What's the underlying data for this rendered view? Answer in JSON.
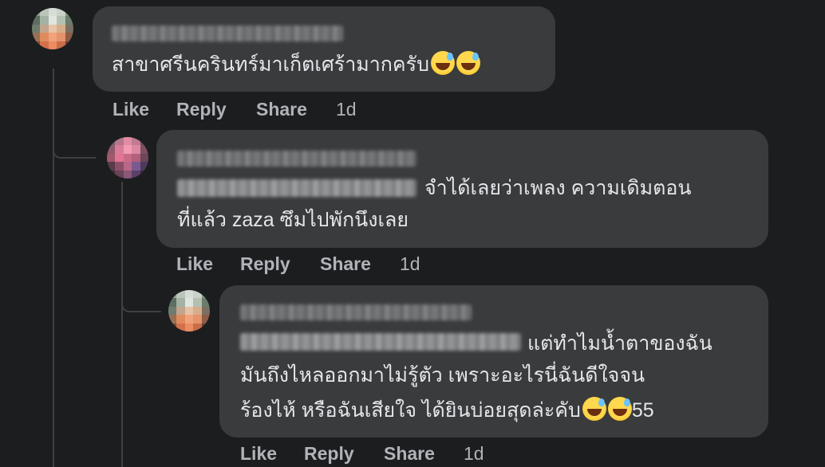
{
  "comments": [
    {
      "text": "สาขาศรีนครินทร์มาเก็ตเศร้ามากครับ",
      "emoji": [
        "grinning-sweat-emoji",
        "grinning-sweat-emoji"
      ],
      "actions": {
        "like": "Like",
        "reply": "Reply",
        "share": "Share",
        "time": "1d"
      }
    },
    {
      "line1": "จำได้เลยว่าเพลง ความเดิมตอน",
      "line2": "ที่แล้ว zaza ซึมไปพักนึงเลย",
      "actions": {
        "like": "Like",
        "reply": "Reply",
        "share": "Share",
        "time": "1d"
      }
    },
    {
      "line1": "แต่ทำไมน้ำตาของฉัน",
      "line2": "มันถึงไหลออกมาไม่รู้ตัว เพราะอะไรนี่ฉันดีใจจน",
      "line3": "ร้องไห้ หรือฉันเสียใจ ได้ยินบ่อยสุดล่ะคับ",
      "suffix": "55",
      "actions": {
        "like": "Like",
        "reply": "Reply",
        "share": "Share",
        "time": "1d"
      }
    }
  ],
  "colors": {
    "background": "#1c1d1f",
    "bubble": "#3a3b3c",
    "text": "#e4e6eb",
    "secondary": "#b0b3b8"
  }
}
